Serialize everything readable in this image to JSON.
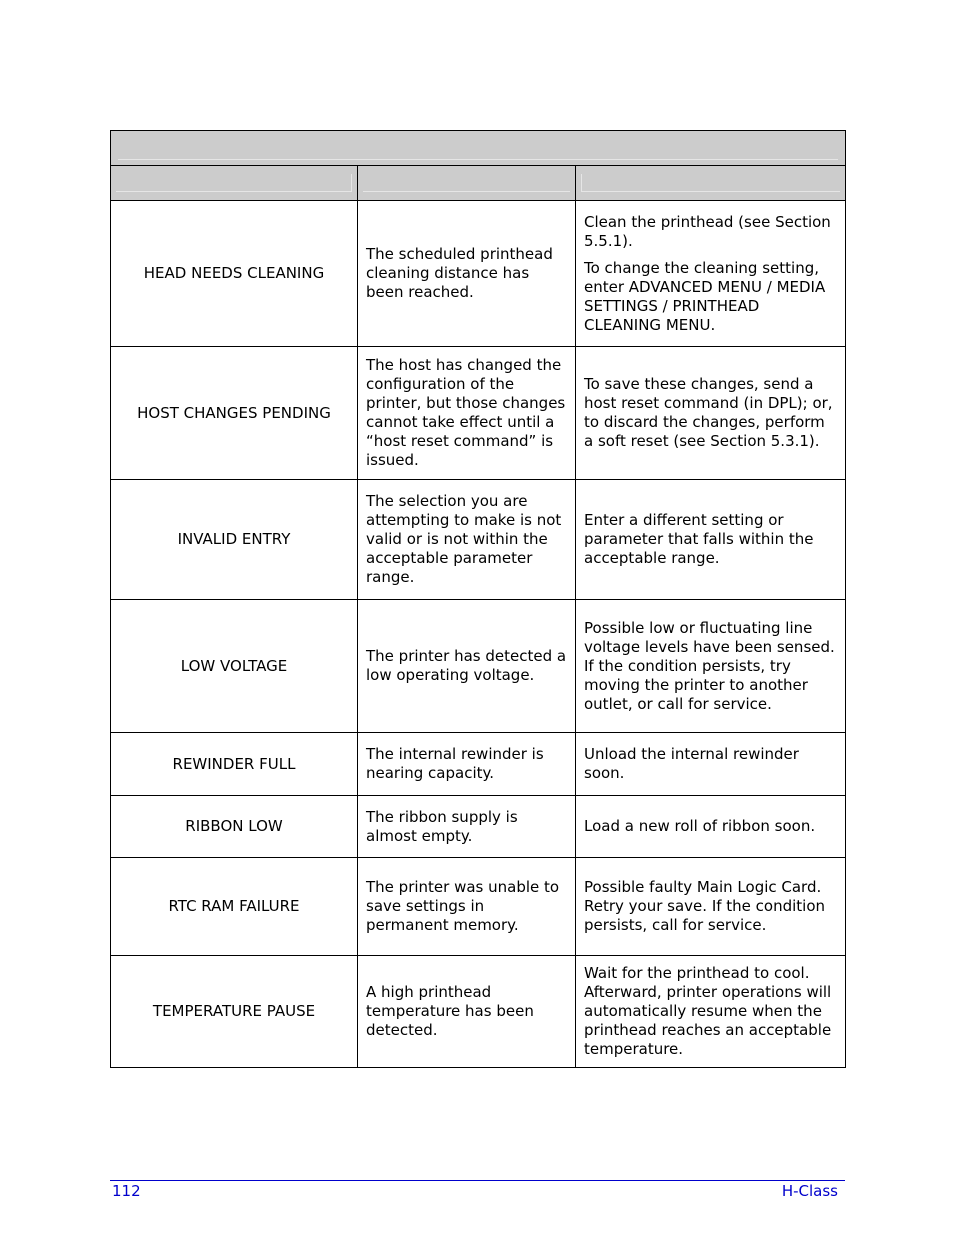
{
  "table": {
    "title": "",
    "headers": [
      "",
      "",
      ""
    ],
    "rows": [
      {
        "message": "HEAD NEEDS CLEANING",
        "description": "The scheduled printhead cleaning distance has been reached.",
        "action": [
          "Clean the printhead (see Section 5.5.1).",
          "To change the cleaning setting, enter ADVANCED MENU / MEDIA SETTINGS / PRINTHEAD CLEANING MENU."
        ]
      },
      {
        "message": "HOST CHANGES PENDING",
        "description": "The host has changed the configuration of the printer, but those changes cannot take effect until a “host reset command” is issued.",
        "action": [
          "To save these changes, send a host reset command (in DPL); or, to discard the changes, perform a soft reset (see Section 5.3.1)."
        ]
      },
      {
        "message": "INVALID ENTRY",
        "description": "The selection you are attempting to make is not valid or is not within the acceptable parameter range.",
        "action": [
          "Enter a different setting or parameter that falls within the acceptable range."
        ]
      },
      {
        "message": "LOW VOLTAGE",
        "description": "The printer has detected a low operating voltage.",
        "action": [
          "Possible low or fluctuating line voltage levels have been sensed. If the condition persists, try moving the printer to another outlet, or call for service."
        ]
      },
      {
        "message": "REWINDER FULL",
        "description": "The internal rewinder is nearing capacity.",
        "action": [
          "Unload the internal rewinder soon."
        ]
      },
      {
        "message": "RIBBON LOW",
        "description": "The ribbon supply is almost empty.",
        "action": [
          "Load a new roll of ribbon soon."
        ]
      },
      {
        "message": "RTC RAM FAILURE",
        "description": "The printer was unable to save settings in permanent memory.",
        "action": [
          "Possible faulty Main Logic Card. Retry your save. If the condition persists, call for service."
        ]
      },
      {
        "message": "TEMPERATURE PAUSE",
        "description": "A high printhead temperature has been detected.",
        "action": [
          "Wait for the printhead to cool. Afterward, printer operations will automatically resume when the printhead reaches an acceptable temperature."
        ]
      }
    ]
  },
  "footer": {
    "page_number": "112",
    "document_name": "H-Class",
    "color": "#0000cc"
  }
}
